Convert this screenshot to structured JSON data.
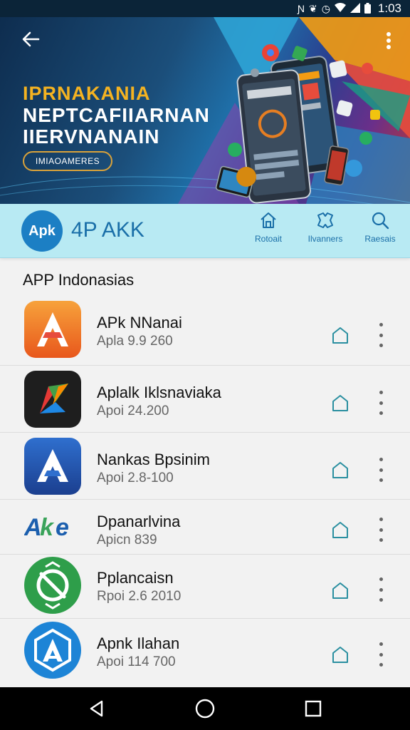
{
  "status_bar": {
    "time": "1:03",
    "icons": [
      "nfc-icon",
      "vibrate-icon",
      "alarm-icon",
      "wifi-icon",
      "signal-icon",
      "battery-icon"
    ]
  },
  "banner": {
    "line1": "IPRNAKANIA",
    "line2": "NEPTCAFIIARNAN",
    "line3": "IIERVNANAIN",
    "pill": "IMIAOAMERES"
  },
  "app_bar": {
    "logo_text": "Apk",
    "title": "4P AKK",
    "nav": [
      {
        "label": "Rotoait",
        "icon": "home-icon"
      },
      {
        "label": "Ilvanners",
        "icon": "category-icon"
      },
      {
        "label": "Raesais",
        "icon": "search-icon"
      }
    ]
  },
  "section_title": "APP Indonasias",
  "apps": [
    {
      "name": "APk NNanai",
      "sub": "Apla 9.9 260",
      "icon": "orange-a-icon"
    },
    {
      "name": "Aplalk Iklsnaviaka",
      "sub": "Apoi 24.200",
      "icon": "colorful-feather-icon"
    },
    {
      "name": "Nankas Bpsinim",
      "sub": "Apoi 2.8-100",
      "icon": "blue-a-icon"
    },
    {
      "name": "Dpanarlvina",
      "sub": "Apicn 839",
      "icon": "ake-logo-icon"
    },
    {
      "name": "Pplancaisn",
      "sub": "Rpoi 2.6 2010",
      "icon": "green-slash-icon"
    },
    {
      "name": "Apnk Ilahan",
      "sub": "Apoi 114 700",
      "icon": "hexagon-a-icon"
    }
  ],
  "colors": {
    "accent": "#1a6fa8",
    "app_bar_bg": "#b8eaf3",
    "teal_icon": "#2a8fa0"
  }
}
